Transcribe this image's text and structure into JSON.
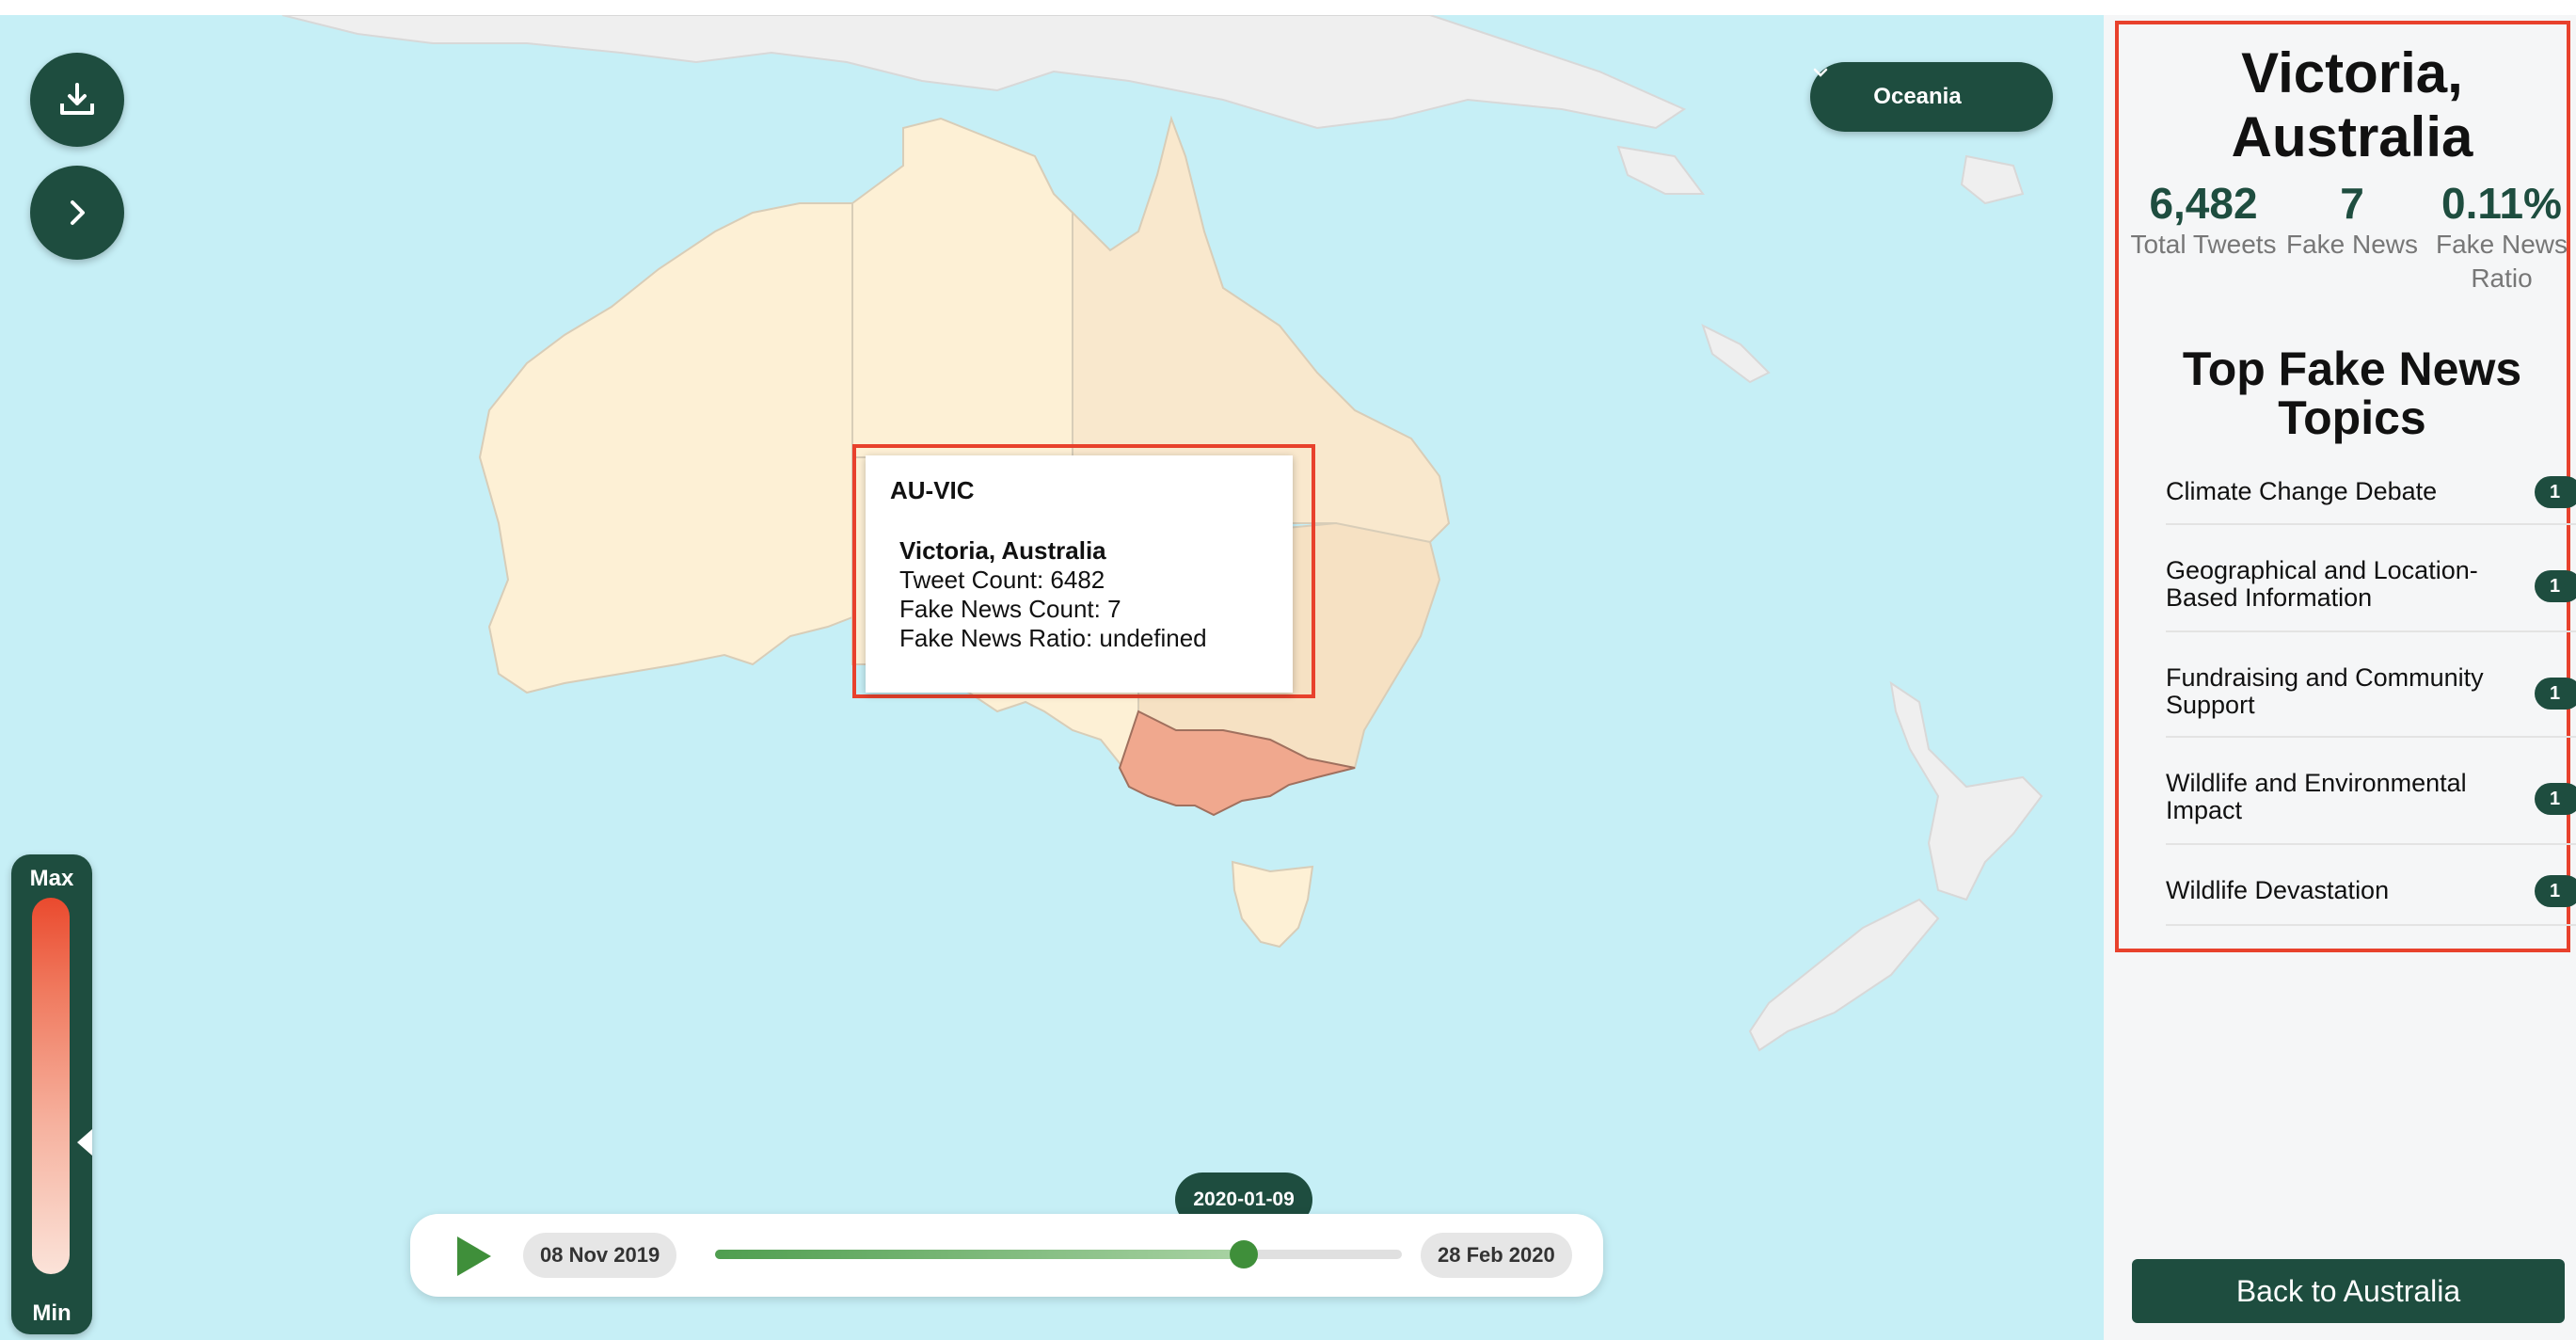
{
  "map": {
    "region_selector": {
      "value": "Oceania"
    },
    "legend": {
      "max_label": "Max",
      "min_label": "Min",
      "marker_level": 0.35
    },
    "tooltip": {
      "code": "AU-VIC",
      "name": "Victoria, Australia",
      "tweet_count": "Tweet Count: 6482",
      "fake_news_count": "Fake News Count: 7",
      "fake_news_ratio": "Fake News Ratio: undefined"
    },
    "timeline": {
      "start": "08 Nov 2019",
      "end": "28 Feb 2020",
      "current": "2020-01-09",
      "progress": 0.77
    },
    "colors": {
      "ocean": "#c6eff6",
      "land_base": "#fdf0d5",
      "land_light": "#f9e8cd",
      "land_mid": "#f6e1c3",
      "highlight": "#f0a88e",
      "other_land": "#efefef"
    }
  },
  "sidebar": {
    "title": "Victoria, Australia",
    "stats": [
      {
        "value": "6,482",
        "label": "Total Tweets"
      },
      {
        "value": "7",
        "label": "Fake News"
      },
      {
        "value": "0.11%",
        "label": "Fake News Ratio"
      }
    ],
    "topics_heading": "Top Fake News Topics",
    "topics": [
      {
        "label": "Climate Change Debate",
        "count": "1"
      },
      {
        "label": "Geographical and Location-Based Information",
        "count": "1"
      },
      {
        "label": "Fundraising and Community Support",
        "count": "1"
      },
      {
        "label": "Wildlife and Environmental Impact",
        "count": "1"
      },
      {
        "label": "Wildlife Devastation",
        "count": "1"
      }
    ],
    "back_button": "Back to Australia"
  }
}
